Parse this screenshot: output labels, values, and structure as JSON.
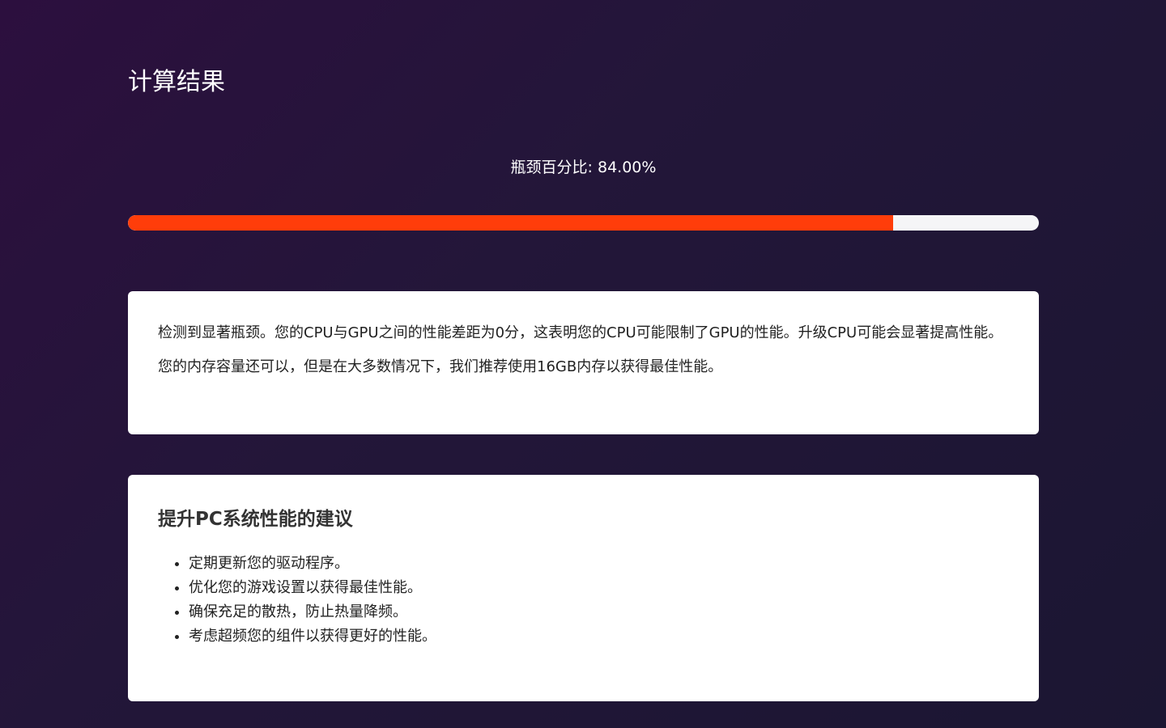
{
  "page": {
    "title": "计算结果"
  },
  "bottleneck": {
    "label": "瓶颈百分比: 84.00%",
    "percent": 84.0,
    "fill_color": "#ff3d0a",
    "track_color": "#f5f5f7"
  },
  "analysis": {
    "paragraphs": [
      "检测到显著瓶颈。您的CPU与GPU之间的性能差距为0分，这表明您的CPU可能限制了GPU的性能。升级CPU可能会显著提高性能。",
      "您的内存容量还可以，但是在大多数情况下，我们推荐使用16GB内存以获得最佳性能。"
    ]
  },
  "tips": {
    "title": "提升PC系统性能的建议",
    "items": [
      "定期更新您的驱动程序。",
      "优化您的游戏设置以获得最佳性能。",
      "确保充足的散热，防止热量降频。",
      "考虑超频您的组件以获得更好的性能。"
    ]
  }
}
